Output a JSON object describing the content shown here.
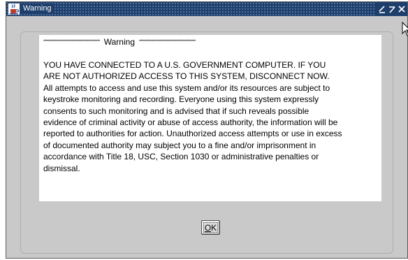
{
  "window": {
    "title": "Warning",
    "title_icon": "java-coffee-cup-icon",
    "controls": [
      "minimize-icon",
      "maximize-icon",
      "close-icon"
    ]
  },
  "message": {
    "header_stars_left": "********************************************",
    "header_title": "Warning",
    "header_stars_right": "********************************************",
    "lines": [
      "YOU  HAVE  CONNECTED TO A U.S. GOVERNMENT  COMPUTER.  IF YOU",
      "ARE NOT AUTHORIZED  ACCESS  TO THIS SYSTEM,  DISCONNECT NOW.",
      "All attempts to access and use this system and/or its resources are subject to",
      "keystroke monitoring and recording.  Everyone using this system expressly",
      "consents to such monitoring and is advised that if such reveals possible",
      "evidence of criminal activity or abuse of access authority, the information will be",
      "reported to authorities for action.  Unauthorized access attempts or use in excess",
      "of documented authority may subject you to a fine and/or imprisonment in",
      "accordance with Title 18, USC, Section 1030 or administrative penalties or",
      "dismissal."
    ]
  },
  "buttons": {
    "ok_mnemonic": "O",
    "ok_rest": "K"
  },
  "colors": {
    "titlebar": "#1e3f6b",
    "window_bg": "#c9c9c9",
    "message_bg": "#ffffff"
  }
}
